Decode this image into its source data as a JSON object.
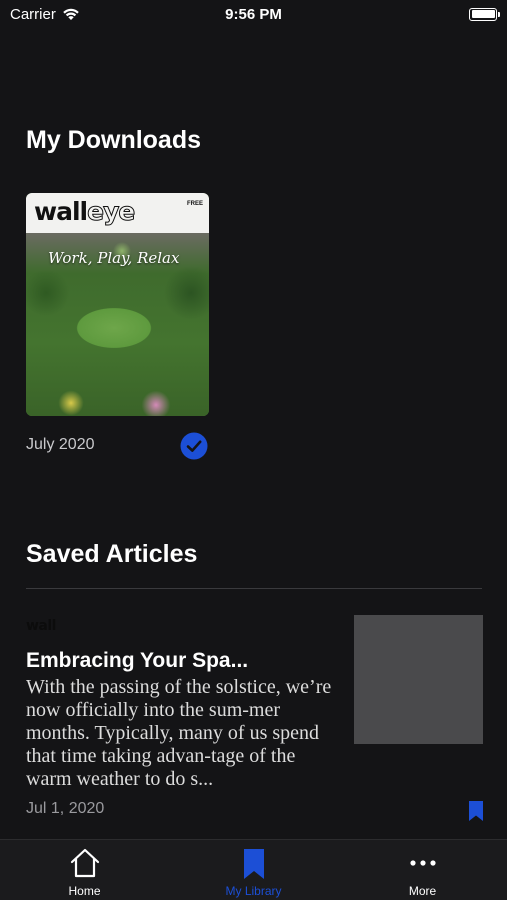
{
  "status_bar": {
    "carrier": "Carrier",
    "time": "9:56 PM",
    "icons": [
      "wifi-icon",
      "battery-icon"
    ]
  },
  "downloads": {
    "title": "My Downloads",
    "issues": [
      {
        "label": "July 2020",
        "downloaded": true,
        "cover": {
          "logo_solid": "wall",
          "logo_outline": "eye",
          "badge": "FREE",
          "headline": "Work, Play, Relax"
        }
      }
    ]
  },
  "saved": {
    "title": "Saved Articles",
    "articles": [
      {
        "publication": "wall",
        "title": "Embracing Your Spa...",
        "excerpt": "With the passing of the solstice, we’re now officially into the sum-mer months. Typically, many of us spend that time taking advan-tage of the warm weather to do s...",
        "date": "Jul 1, 2020",
        "bookmarked": true
      }
    ]
  },
  "tab_bar": {
    "tabs": [
      {
        "label": "Home",
        "icon": "home-icon",
        "active": false
      },
      {
        "label": "My Library",
        "icon": "bookmark-icon",
        "active": true
      },
      {
        "label": "More",
        "icon": "ellipsis-icon",
        "active": false
      }
    ]
  },
  "colors": {
    "background": "#141416",
    "accent": "#1c4fd6",
    "tab_bar": "#1b1b1d"
  }
}
